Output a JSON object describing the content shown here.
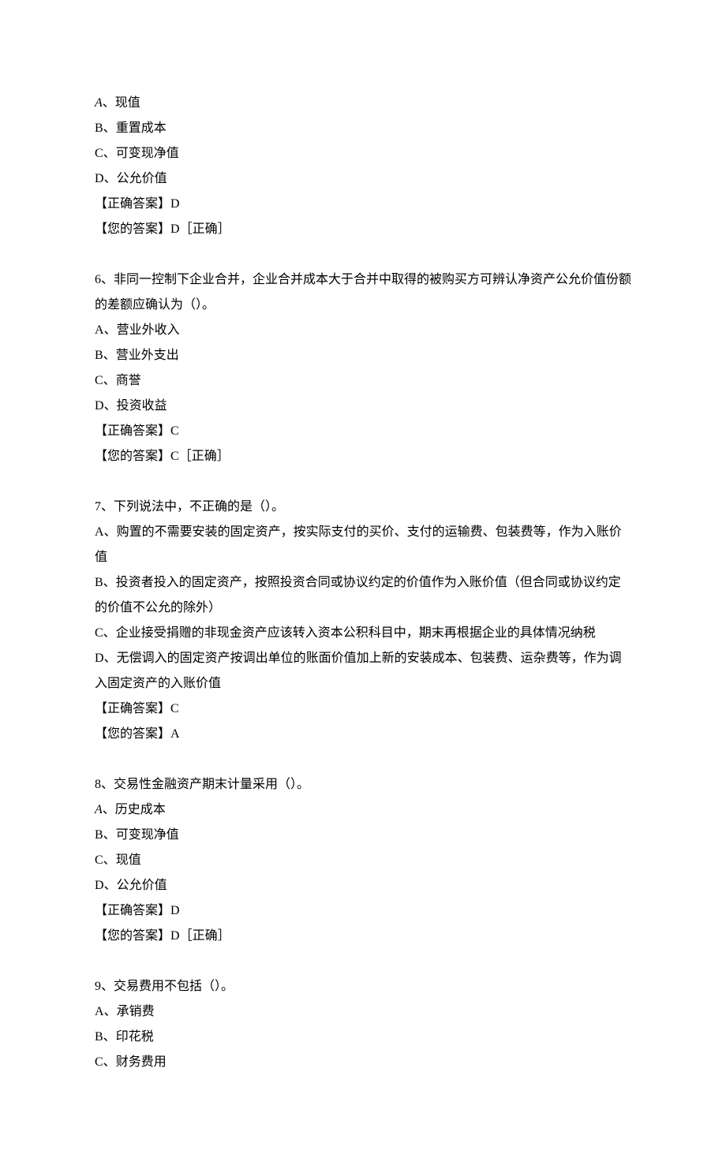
{
  "q5_partial": {
    "options": [
      {
        "letter": "A",
        "text": "现值",
        "italic": true
      },
      {
        "letter": "B",
        "text": "重置成本",
        "italic": false
      },
      {
        "letter": "C",
        "text": "可变现净值",
        "italic": false
      },
      {
        "letter": "D",
        "text": "公允价值",
        "italic": false
      }
    ],
    "correct_label": "【正确答案】",
    "correct_value": "D",
    "your_label": "【您的答案】",
    "your_value": "D［正确］"
  },
  "q6": {
    "stem": "6、非同一控制下企业合并，企业合并成本大于合并中取得的被购买方可辨认净资产公允价值份额的差额应确认为（）。",
    "options": [
      {
        "letter": "A",
        "text": "营业外收入"
      },
      {
        "letter": "B",
        "text": "营业外支出"
      },
      {
        "letter": "C",
        "text": "商誉"
      },
      {
        "letter": "D",
        "text": "投资收益"
      }
    ],
    "correct_label": "【正确答案】",
    "correct_value": "C",
    "your_label": "【您的答案】",
    "your_value": "C［正确］"
  },
  "q7": {
    "stem": "7、下列说法中，不正确的是（）。",
    "options": [
      {
        "letter": "A",
        "text": "购置的不需要安装的固定资产，按实际支付的买价、支付的运输费、包装费等，作为入账价值"
      },
      {
        "letter": "B",
        "text": "投资者投入的固定资产，按照投资合同或协议约定的价值作为入账价值（但合同或协议约定的价值不公允的除外）"
      },
      {
        "letter": "C",
        "text": "企业接受捐赠的非现金资产应该转入资本公积科目中，期末再根据企业的具体情况纳税"
      },
      {
        "letter": "D",
        "text": "无偿调入的固定资产按调出单位的账面价值加上新的安装成本、包装费、运杂费等，作为调入固定资产的入账价值"
      }
    ],
    "correct_label": "【正确答案】",
    "correct_value": "C",
    "your_label": "【您的答案】",
    "your_value": "A"
  },
  "q8": {
    "stem": "8、交易性金融资产期末计量采用（）。",
    "options": [
      {
        "letter": "A",
        "text": "历史成本",
        "italic": true
      },
      {
        "letter": "B",
        "text": "可变现净值",
        "italic": false
      },
      {
        "letter": "C",
        "text": "现值",
        "italic": false
      },
      {
        "letter": "D",
        "text": "公允价值",
        "italic": false
      }
    ],
    "correct_label": "【正确答案】",
    "correct_value": "D",
    "your_label": "【您的答案】",
    "your_value": "D［正确］"
  },
  "q9": {
    "stem": "9、交易费用不包括（）。",
    "options": [
      {
        "letter": "A",
        "text": "承销费"
      },
      {
        "letter": "B",
        "text": "印花税"
      },
      {
        "letter": "C",
        "text": "财务费用"
      }
    ]
  }
}
